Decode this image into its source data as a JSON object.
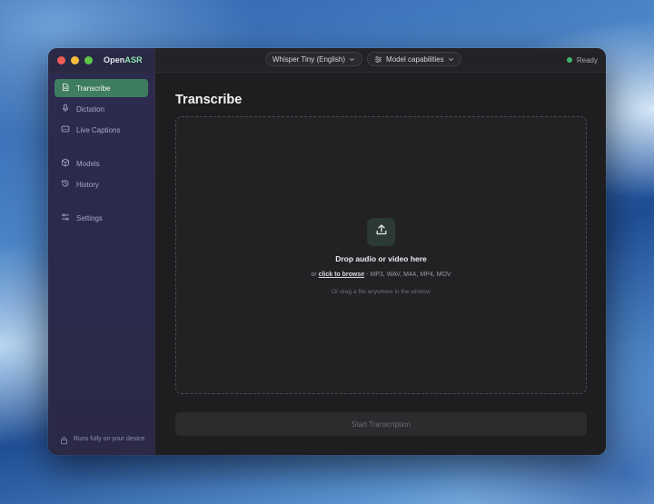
{
  "app": {
    "name_prefix": "Open",
    "name_accent": "ASR"
  },
  "header": {
    "model_selector": "Whisper Tiny (English)",
    "capabilities_button": "Model capabilities",
    "status": "Ready",
    "status_color": "#3fb46a"
  },
  "sidebar": {
    "items": [
      {
        "label": "Transcribe",
        "icon": "document-icon",
        "active": true
      },
      {
        "label": "Dictation",
        "icon": "microphone-icon"
      },
      {
        "label": "Live Captions",
        "icon": "captions-icon"
      },
      {
        "label": "Models",
        "icon": "cube-icon"
      },
      {
        "label": "History",
        "icon": "history-icon"
      },
      {
        "label": "Settings",
        "icon": "sliders-icon"
      }
    ],
    "footer": "Runs fully on your device"
  },
  "main": {
    "title": "Transcribe",
    "dropzone": {
      "title": "Drop audio or video here",
      "sub_prefix": "or",
      "browse_link": "click to browse",
      "formats": "- MP3, WAV, M4A, MP4, MOV",
      "hint": "Or drag a file anywhere in the window"
    },
    "start_button": "Start Transcription"
  },
  "colors": {
    "accent": "#3e7d5f",
    "sidebar": "#2b2a4b",
    "background": "#1e1e20"
  }
}
